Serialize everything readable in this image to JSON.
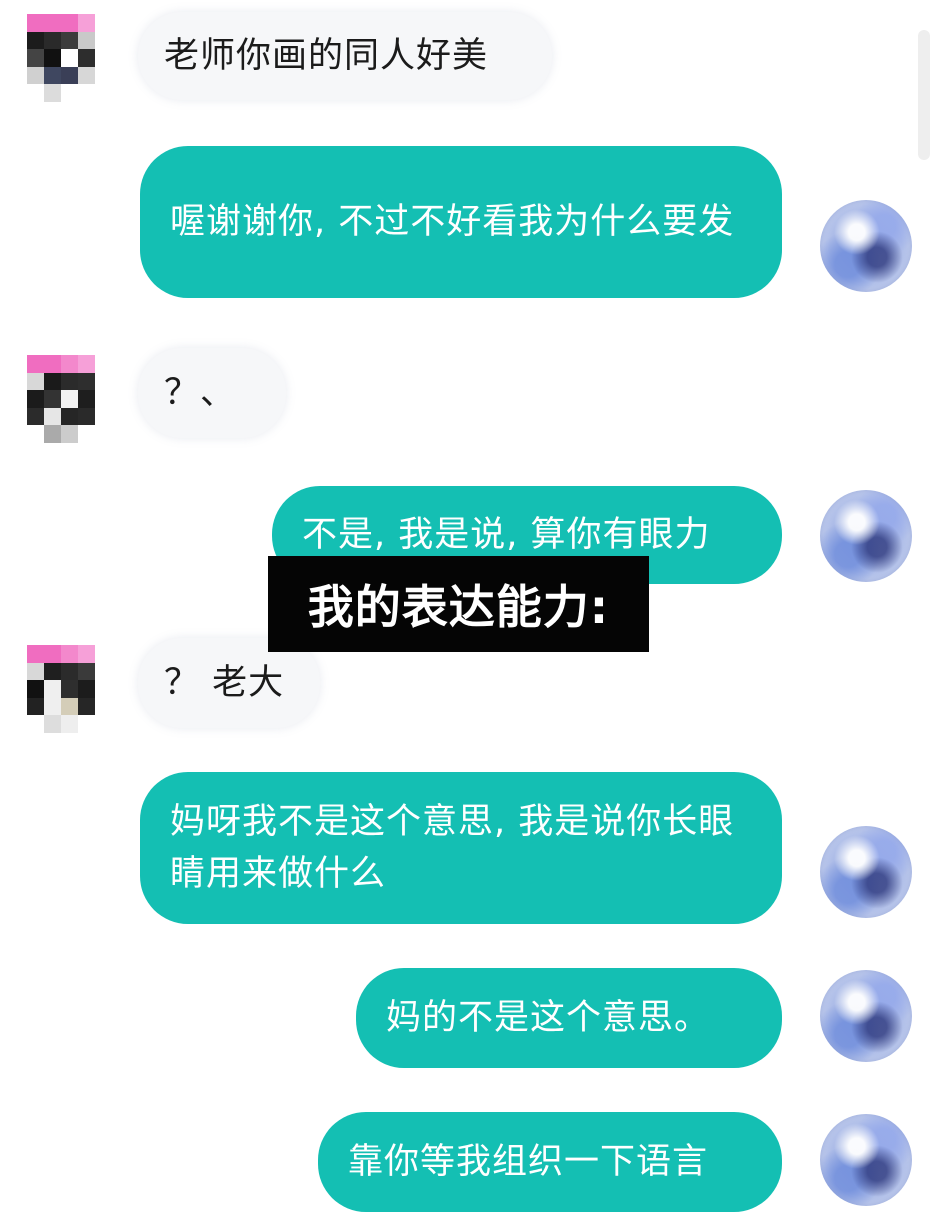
{
  "caption": {
    "text": "我的表达能力:"
  },
  "messages": [
    {
      "side": "left",
      "text": "老师你画的同人好美"
    },
    {
      "side": "right",
      "text": "喔谢谢你, 不过不好看我为什么要发"
    },
    {
      "side": "left",
      "text": "？、"
    },
    {
      "side": "right",
      "text": "不是, 我是说, 算你有眼力"
    },
    {
      "side": "left",
      "text": "？ 老大"
    },
    {
      "side": "right",
      "text": "妈呀我不是这个意思, 我是说你长眼睛用来做什么"
    },
    {
      "side": "right",
      "text": "妈的不是这个意思。"
    },
    {
      "side": "right",
      "text": "靠你等我组织一下语言"
    }
  ],
  "colors": {
    "sent_bubble": "#14bfb3",
    "received_bubble": "#f6f7f9",
    "caption_bg": "#050505"
  },
  "icons": {
    "received_avatar": "pixelated-avatar",
    "sent_avatar": "anime-avatar"
  }
}
